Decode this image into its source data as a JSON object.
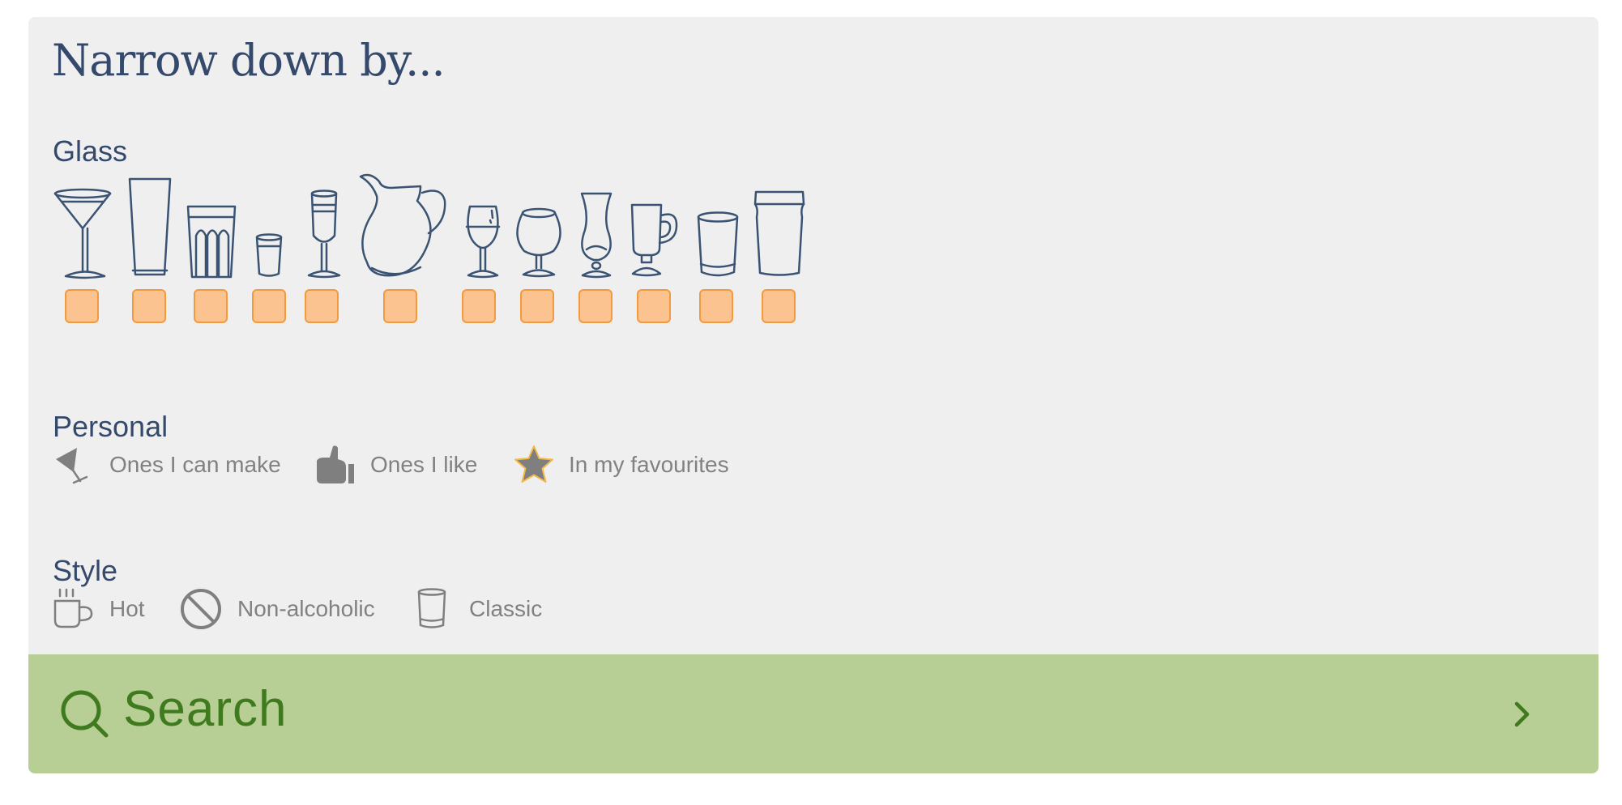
{
  "panel": {
    "title": "Narrow down by...",
    "colors": {
      "panel_bg": "#efefef",
      "heading": "#34496b",
      "checkbox_fill": "#fbc38f",
      "checkbox_border": "#f39a3e",
      "search_bg": "#b7ce94",
      "search_text": "#3f7a1e",
      "option_text": "#818181"
    }
  },
  "glass": {
    "heading": "Glass",
    "items": [
      {
        "icon": "cocktail-glass-icon",
        "checked": false
      },
      {
        "icon": "highball-glass-icon",
        "checked": false
      },
      {
        "icon": "fluted-tumbler-icon",
        "checked": false
      },
      {
        "icon": "shot-glass-icon",
        "checked": false
      },
      {
        "icon": "champagne-flute-icon",
        "checked": false
      },
      {
        "icon": "pitcher-icon",
        "checked": false
      },
      {
        "icon": "wine-glass-icon",
        "checked": false
      },
      {
        "icon": "brandy-snifter-icon",
        "checked": false
      },
      {
        "icon": "hurricane-glass-icon",
        "checked": false
      },
      {
        "icon": "irish-coffee-mug-icon",
        "checked": false
      },
      {
        "icon": "old-fashioned-glass-icon",
        "checked": false
      },
      {
        "icon": "pint-glass-icon",
        "checked": false
      }
    ]
  },
  "personal": {
    "heading": "Personal",
    "options": [
      {
        "label": "Ones I can make",
        "icon": "cocktail-glass-tilted-icon"
      },
      {
        "label": "Ones I like",
        "icon": "thumbs-up-icon"
      },
      {
        "label": "In my favourites",
        "icon": "star-icon"
      }
    ]
  },
  "style": {
    "heading": "Style",
    "options": [
      {
        "label": "Hot",
        "icon": "hot-cup-icon"
      },
      {
        "label": "Non-alcoholic",
        "icon": "prohibited-icon"
      },
      {
        "label": "Classic",
        "icon": "tumbler-icon"
      }
    ]
  },
  "search": {
    "label": "Search",
    "icon": "search-icon",
    "arrow_icon": "chevron-right-icon"
  }
}
